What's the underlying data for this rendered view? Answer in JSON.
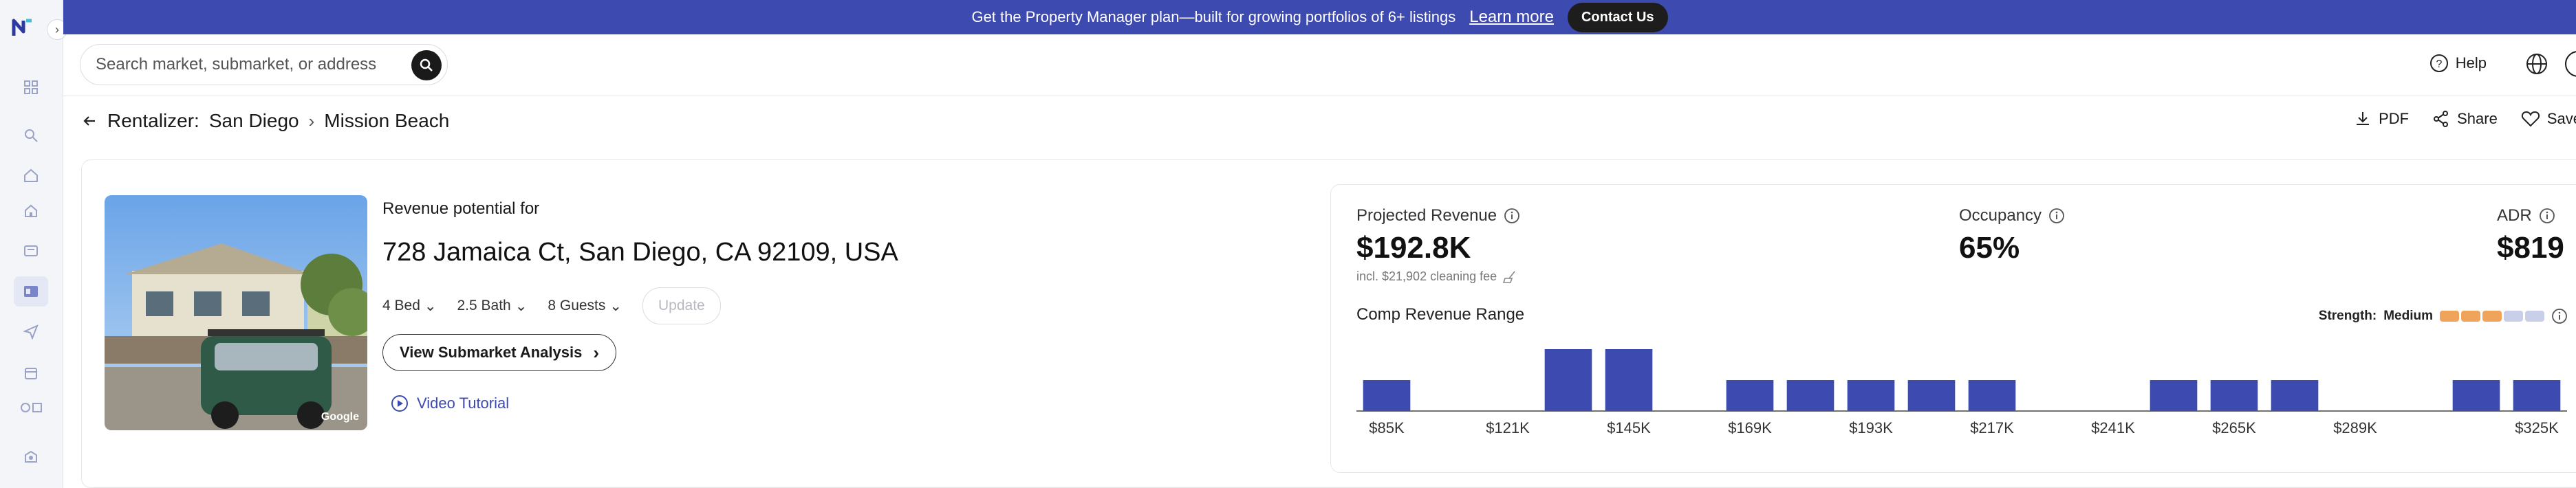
{
  "banner": {
    "message": "Get the Property Manager plan—built for growing portfolios of 6+ listings",
    "learn_more": "Learn more",
    "contact": "Contact Us"
  },
  "header": {
    "search_placeholder": "Search market, submarket, or address",
    "help": "Help"
  },
  "breadcrumb": {
    "root": "Rentalizer:",
    "city": "San Diego",
    "submarket": "Mission Beach"
  },
  "actions": {
    "pdf": "PDF",
    "share": "Share",
    "save": "Save"
  },
  "property": {
    "label": "Revenue potential for",
    "address": "728 Jamaica Ct, San Diego, CA 92109, USA",
    "beds": "4 Bed",
    "baths": "2.5 Bath",
    "guests": "8 Guests",
    "update": "Update",
    "view_submarket": "View Submarket Analysis",
    "video_tutorial": "Video Tutorial",
    "photo_credit": "Google"
  },
  "metrics": {
    "projected_label": "Projected Revenue",
    "projected_value": "$192.8K",
    "cleaning_note": "incl. $21,902 cleaning fee",
    "occupancy_label": "Occupancy",
    "occupancy_value": "65%",
    "adr_label": "ADR",
    "adr_value": "$819"
  },
  "comp_range": {
    "title": "Comp Revenue Range",
    "strength_label": "Strength:",
    "strength_value": "Medium",
    "strength_segments": [
      "#f0a35a",
      "#f0a35a",
      "#f0a35a",
      "#c9cfe8",
      "#c9cfe8"
    ]
  },
  "chart_data": {
    "type": "bar",
    "title": "Comp Revenue Range",
    "bar_color": "#3d4aaf",
    "tick_labels": [
      "$85K",
      "$121K",
      "$145K",
      "$169K",
      "$193K",
      "$217K",
      "$241K",
      "$265K",
      "$289K",
      "$325K"
    ],
    "values": [
      1,
      0,
      0,
      2,
      2,
      0,
      1,
      1,
      1,
      1,
      1,
      0,
      0,
      1,
      1,
      1,
      0,
      0,
      1,
      1
    ],
    "ylim": [
      0,
      2
    ]
  },
  "colors": {
    "brand": "#3d4aaf",
    "banner": "#3d4aaf"
  }
}
